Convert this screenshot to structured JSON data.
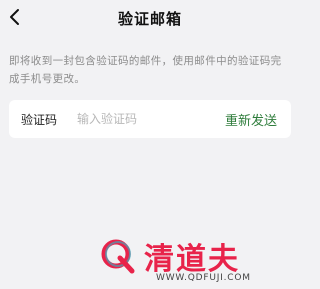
{
  "header": {
    "title": "验证邮箱",
    "back_icon": "chevron-left-icon"
  },
  "description": "即将收到一封包含验证码的邮件，使用邮件中的验证码完成手机号更改。",
  "form": {
    "code_label": "验证码",
    "code_placeholder": "输入验证码",
    "code_value": "",
    "resend_label": "重新发送"
  },
  "watermark": {
    "brand_text": "清道夫",
    "url_text": "WWW.QDFUJI.COM",
    "logo_icon": "q-logo-icon"
  },
  "colors": {
    "background": "#f2f2f4",
    "accent_green": "#2f7d3c",
    "watermark_red": "#e8234a"
  }
}
